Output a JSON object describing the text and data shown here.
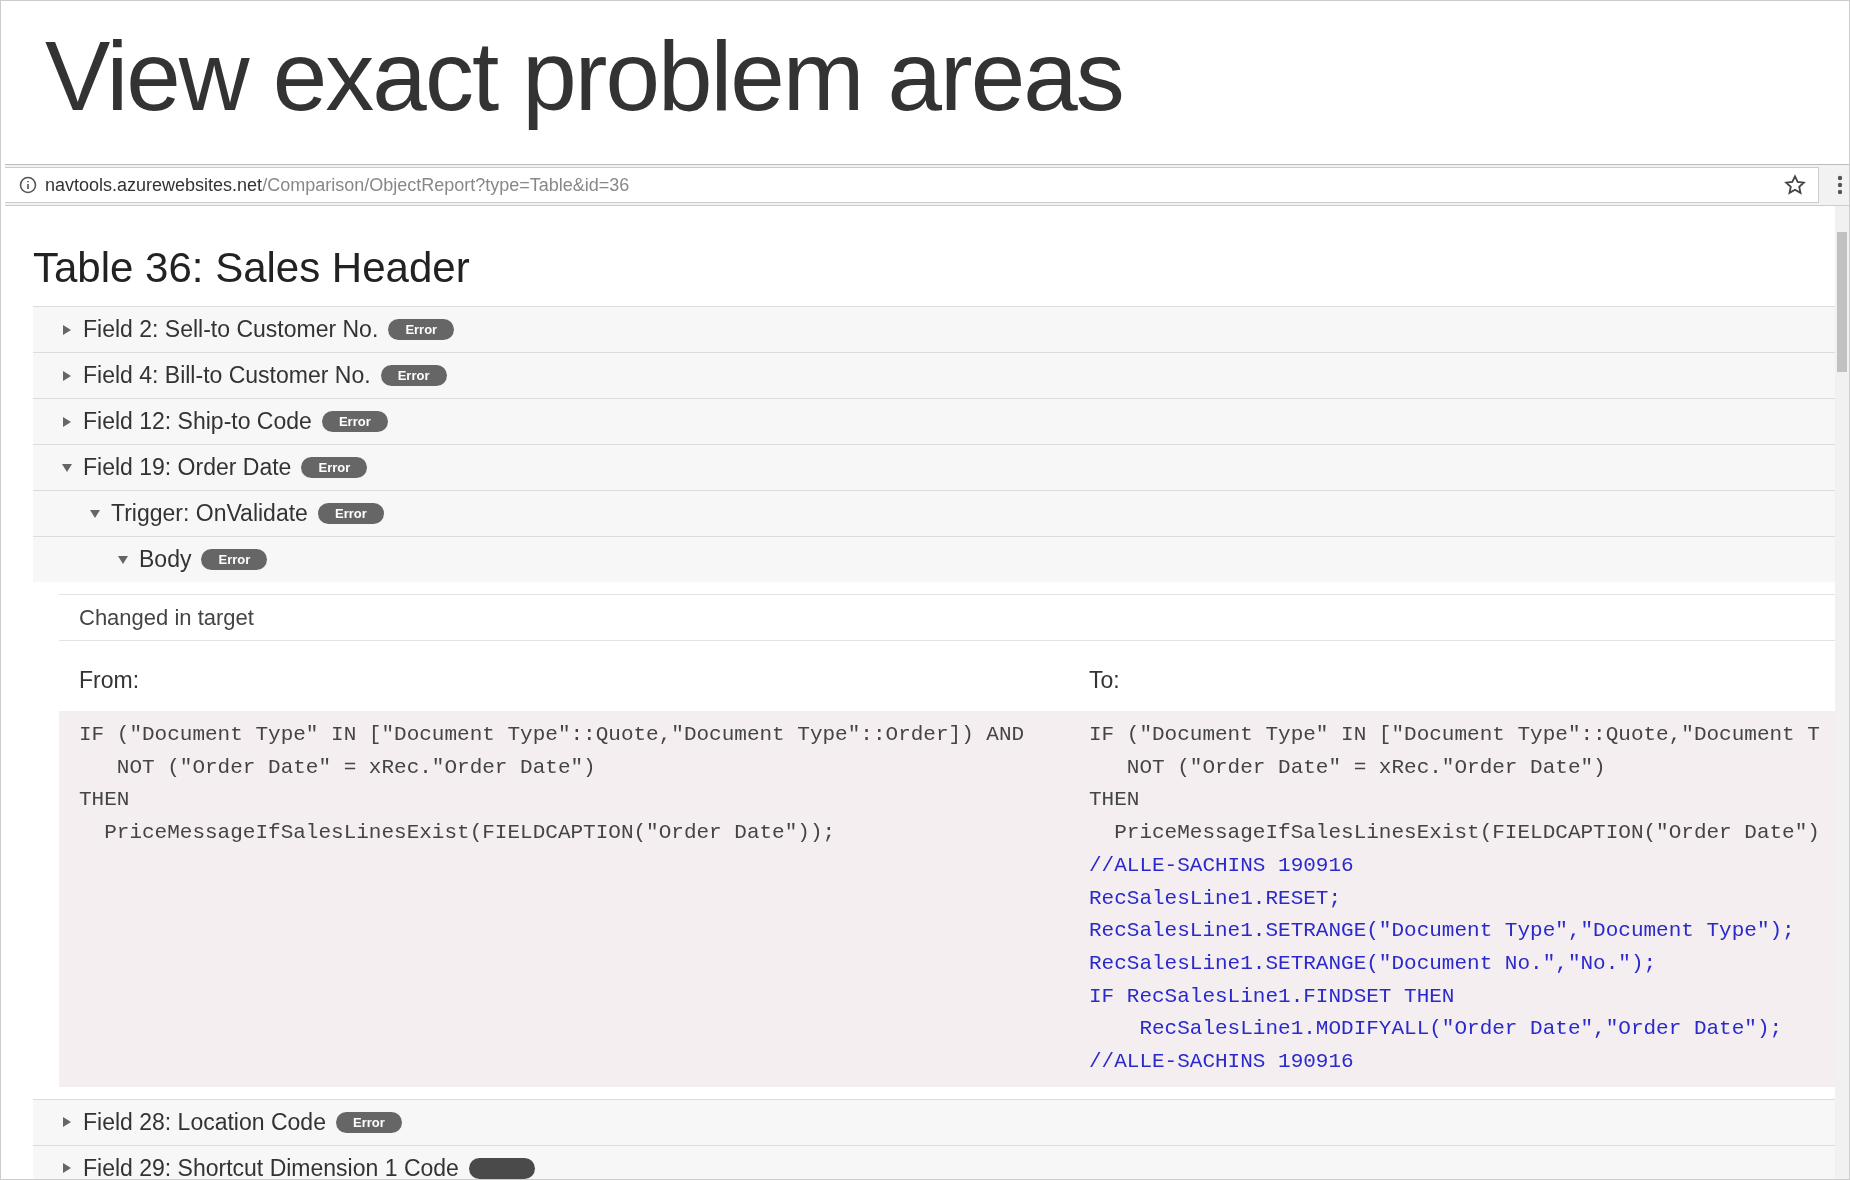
{
  "slide_title": "View exact problem areas",
  "address_bar": {
    "domain": "navtools.azurewebsites.net",
    "path": "/Comparison/ObjectReport?type=Table&id=36"
  },
  "page_title": "Table 36: Sales Header",
  "rows": [
    {
      "label": "Field 2: Sell-to Customer No.",
      "badge": "Error",
      "kind": "error",
      "expanded": false
    },
    {
      "label": "Field 4: Bill-to Customer No.",
      "badge": "Error",
      "kind": "error",
      "expanded": false
    },
    {
      "label": "Field 12: Ship-to Code",
      "badge": "Error",
      "kind": "error",
      "expanded": false
    },
    {
      "label": "Field 19: Order Date",
      "badge": "Error",
      "kind": "error",
      "expanded": true,
      "children": [
        {
          "label": "Trigger: OnValidate",
          "badge": "Error",
          "kind": "error",
          "expanded": true,
          "children": [
            {
              "label": "Body",
              "badge": "Error",
              "kind": "error",
              "expanded": true,
              "detail": {
                "change": "Changed in target",
                "from_label": "From:",
                "to_label": "To:",
                "from_lines": [
                  {
                    "text": "IF (\"Document Type\" IN [\"Document Type\"::Quote,\"Document Type\"::Order]) AND",
                    "kind": "same"
                  },
                  {
                    "text": "   NOT (\"Order Date\" = xRec.\"Order Date\")",
                    "kind": "same"
                  },
                  {
                    "text": "THEN",
                    "kind": "same"
                  },
                  {
                    "text": "  PriceMessageIfSalesLinesExist(FIELDCAPTION(\"Order Date\"));",
                    "kind": "same"
                  }
                ],
                "to_lines": [
                  {
                    "text": "IF (\"Document Type\" IN [\"Document Type\"::Quote,\"Document T",
                    "kind": "same"
                  },
                  {
                    "text": "   NOT (\"Order Date\" = xRec.\"Order Date\")",
                    "kind": "same"
                  },
                  {
                    "text": "THEN",
                    "kind": "same"
                  },
                  {
                    "text": "  PriceMessageIfSalesLinesExist(FIELDCAPTION(\"Order Date\")",
                    "kind": "same"
                  },
                  {
                    "text": "//ALLE-SACHINS 190916",
                    "kind": "added"
                  },
                  {
                    "text": "RecSalesLine1.RESET;",
                    "kind": "added"
                  },
                  {
                    "text": "RecSalesLine1.SETRANGE(\"Document Type\",\"Document Type\");",
                    "kind": "added"
                  },
                  {
                    "text": "RecSalesLine1.SETRANGE(\"Document No.\",\"No.\");",
                    "kind": "added"
                  },
                  {
                    "text": "IF RecSalesLine1.FINDSET THEN",
                    "kind": "added"
                  },
                  {
                    "text": "    RecSalesLine1.MODIFYALL(\"Order Date\",\"Order Date\");",
                    "kind": "added"
                  },
                  {
                    "text": "//ALLE-SACHINS 190916",
                    "kind": "added"
                  }
                ]
              }
            }
          ]
        }
      ]
    },
    {
      "label": "Field 28: Location Code",
      "badge": "Error",
      "kind": "error",
      "expanded": false
    },
    {
      "label": "Field 29: Shortcut Dimension 1 Code",
      "kind": "warning",
      "expanded": false
    }
  ]
}
